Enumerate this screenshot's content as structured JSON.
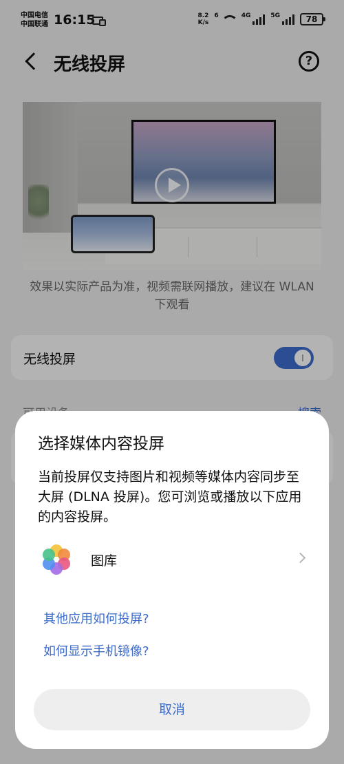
{
  "status_bar": {
    "carrier_1": "中国电信",
    "carrier_2": "中国联通",
    "time": "16:15",
    "speed_value": "8.2",
    "speed_unit": "K/s",
    "wifi_tag": "6",
    "net_1": "4G",
    "net_2": "5G",
    "battery": "78"
  },
  "header": {
    "title": "无线投屏",
    "back_icon": "chevron-left",
    "help_icon": "question-circle",
    "help_glyph": "?"
  },
  "hero": {
    "caption": "效果以实际产品为准，视频需联网播放，建议在 WLAN 下观看",
    "play_icon": "play-circle"
  },
  "toggle": {
    "label": "无线投屏",
    "enabled": true,
    "accent_color": "#3c6bc9"
  },
  "devices": {
    "section_label": "可用设备",
    "action_label": "搜索"
  },
  "dialog": {
    "title": "选择媒体内容投屏",
    "body": "当前投屏仅支持图片和视频等媒体内容同步至大屏 (DLNA 投屏)。您可浏览或播放以下应用的内容投屏。",
    "apps": [
      {
        "label": "图库",
        "icon": "gallery-icon"
      }
    ],
    "link_1": "其他应用如何投屏?",
    "link_2": "如何显示手机镜像?",
    "cancel_label": "取消"
  }
}
